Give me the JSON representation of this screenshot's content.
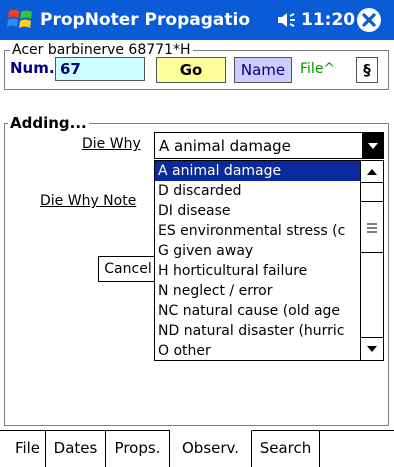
{
  "title_bar": {
    "app_title": "PropNoter Propagatio",
    "clock": "11:20",
    "start_icon": "windows-flag-icon",
    "speaker_icon": "speaker-icon",
    "close_icon": "close-icon"
  },
  "record": {
    "legend": "Acer barbinerve 68771*H",
    "num_label": "Num.",
    "num_value": "67",
    "go_label": "Go",
    "name_label": "Name",
    "file_label": "File^",
    "section_label": "§"
  },
  "adding": {
    "legend": "Adding...",
    "die_why_label": "Die Why",
    "die_why_value": "A animal damage",
    "die_why_note_label": "Die Why Note",
    "cancel_partial": "Cancel",
    "options": [
      "A animal damage",
      "D discarded",
      "DI disease",
      "ES environmental stress (c",
      "G given away",
      "H horticultural failure",
      "N neglect / error",
      "NC natural cause (old age",
      "ND natural disaster (hurric",
      "O other"
    ],
    "selected_index": 0
  },
  "tabs": [
    "File",
    "Dates",
    "Props.",
    "Observ.",
    "Search"
  ],
  "active_tab": "Observ.",
  "colors": {
    "title_bar": "#0a5bd6",
    "num_input": "#ccffff",
    "go_button": "#ffff99",
    "name_button": "#ccccff",
    "file_link": "#009900",
    "selection": "#0a2a9b"
  }
}
